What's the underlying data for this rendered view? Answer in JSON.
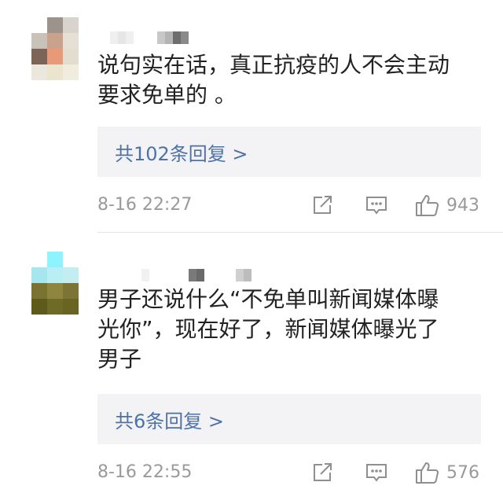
{
  "comments": [
    {
      "text": "说句实在话，真正抗疫的人不会主动\n要求免单的 。",
      "replies_label": "共102条回复 >",
      "time": "8-16 22:27",
      "likes": "943"
    },
    {
      "text": "男子还说什么“不免单叫新闻媒体曝\n光你”，现在好了，新闻媒体曝光了\n男子",
      "replies_label": "共6条回复 >",
      "time": "8-16 22:55",
      "likes": "576"
    }
  ],
  "icons": {
    "share": "share-icon",
    "comment": "comment-icon",
    "like": "thumbs-up-icon"
  },
  "colors": {
    "link": "#4e72a8",
    "meta": "#9a9a9a",
    "reply_bg": "#f3f3f5",
    "text": "#222222"
  }
}
